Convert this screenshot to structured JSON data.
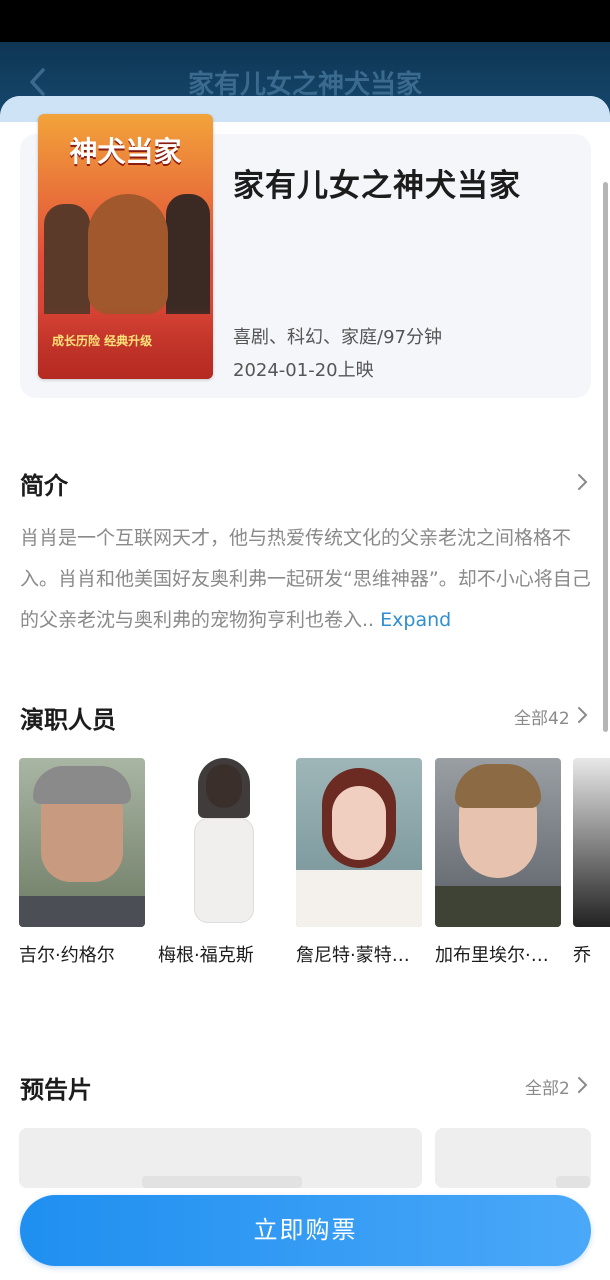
{
  "nav": {
    "title": "家有儿女之神犬当家"
  },
  "movie": {
    "poster_title": "神犬当家",
    "poster_tag": "成长历险 经典升级",
    "name": "家有儿女之神犬当家",
    "genre": "喜剧、科幻、家庭/97分钟",
    "release": "2024-01-20上映"
  },
  "synopsis": {
    "title": "简介",
    "text": "肖肖是一个互联网天才，他与热爱传统文化的父亲老沈之间格格不入。肖肖和他美国好友奥利弗一起研发“思维神器”。却不小心将自己的父亲老沈与奥利弗的宠物狗亨利也卷入..",
    "expand_label": "Expand"
  },
  "cast": {
    "title": "演职人员",
    "more_label": "全部42",
    "members": [
      {
        "name": "吉尔·约格尔"
      },
      {
        "name": "梅根·福克斯"
      },
      {
        "name": "詹尼特·蒙特…"
      },
      {
        "name": "加布里埃尔·…"
      },
      {
        "name": "乔"
      }
    ]
  },
  "trailers": {
    "title": "预告片",
    "more_label": "全部2"
  },
  "buy_button": {
    "label": "立即购票"
  },
  "colors": {
    "accent": "#1f8ff0",
    "link": "#2f8fd0",
    "text": "#1c1c1c",
    "muted": "#8a8a8a"
  },
  "icons": {
    "back": "chevron-left-icon",
    "more": "chevron-right-icon"
  }
}
